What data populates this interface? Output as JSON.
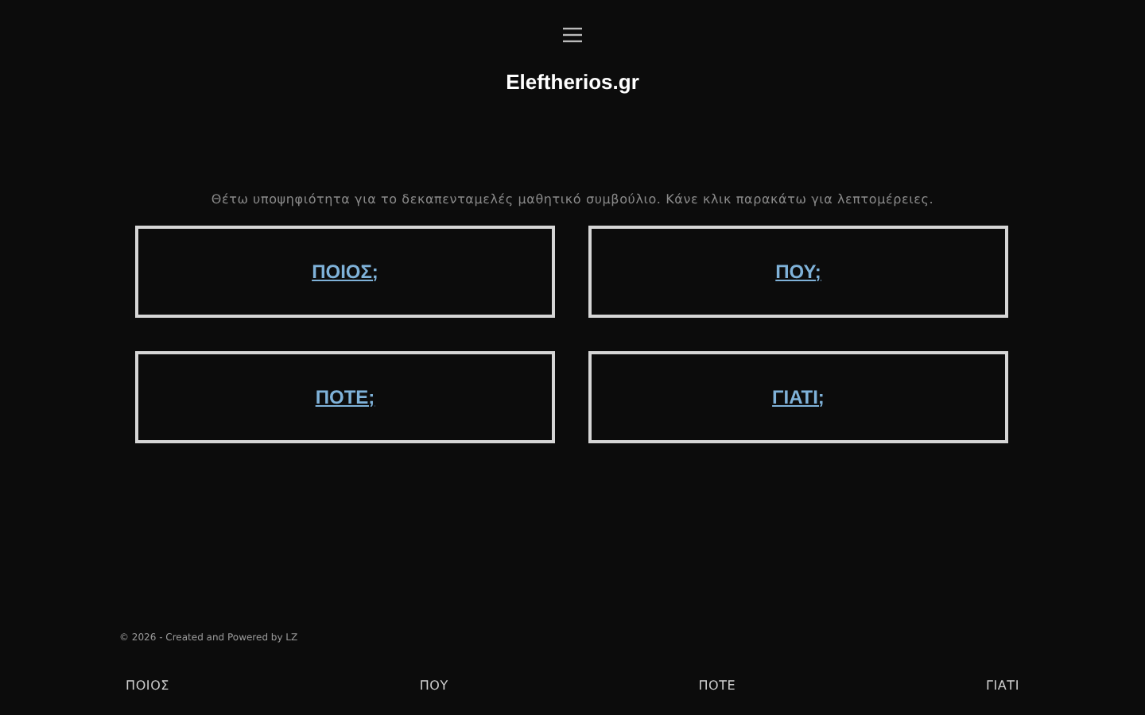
{
  "header": {
    "title": "Eleftherios.gr"
  },
  "intro": "Θέτω υποψηφιότητα για το δεκαπενταμελές μαθητικό συμβούλιο.  Κάνε κλικ παρακάτω για λεπτομέρειες.",
  "cards": [
    {
      "link": "ΠΟΙΟΣ;"
    },
    {
      "link": "ΠΟΥ;"
    },
    {
      "link": "ΠΟΤΕ;"
    },
    {
      "link": "ΓΙΑΤΙ;"
    }
  ],
  "footer": {
    "copyright": "© 2026 - Created and Powered by LZ",
    "nav": [
      "ΠΟΙΟΣ",
      "ΠΟΥ",
      "ΠΟΤΕ",
      "ΓΙΑΤΙ"
    ]
  }
}
